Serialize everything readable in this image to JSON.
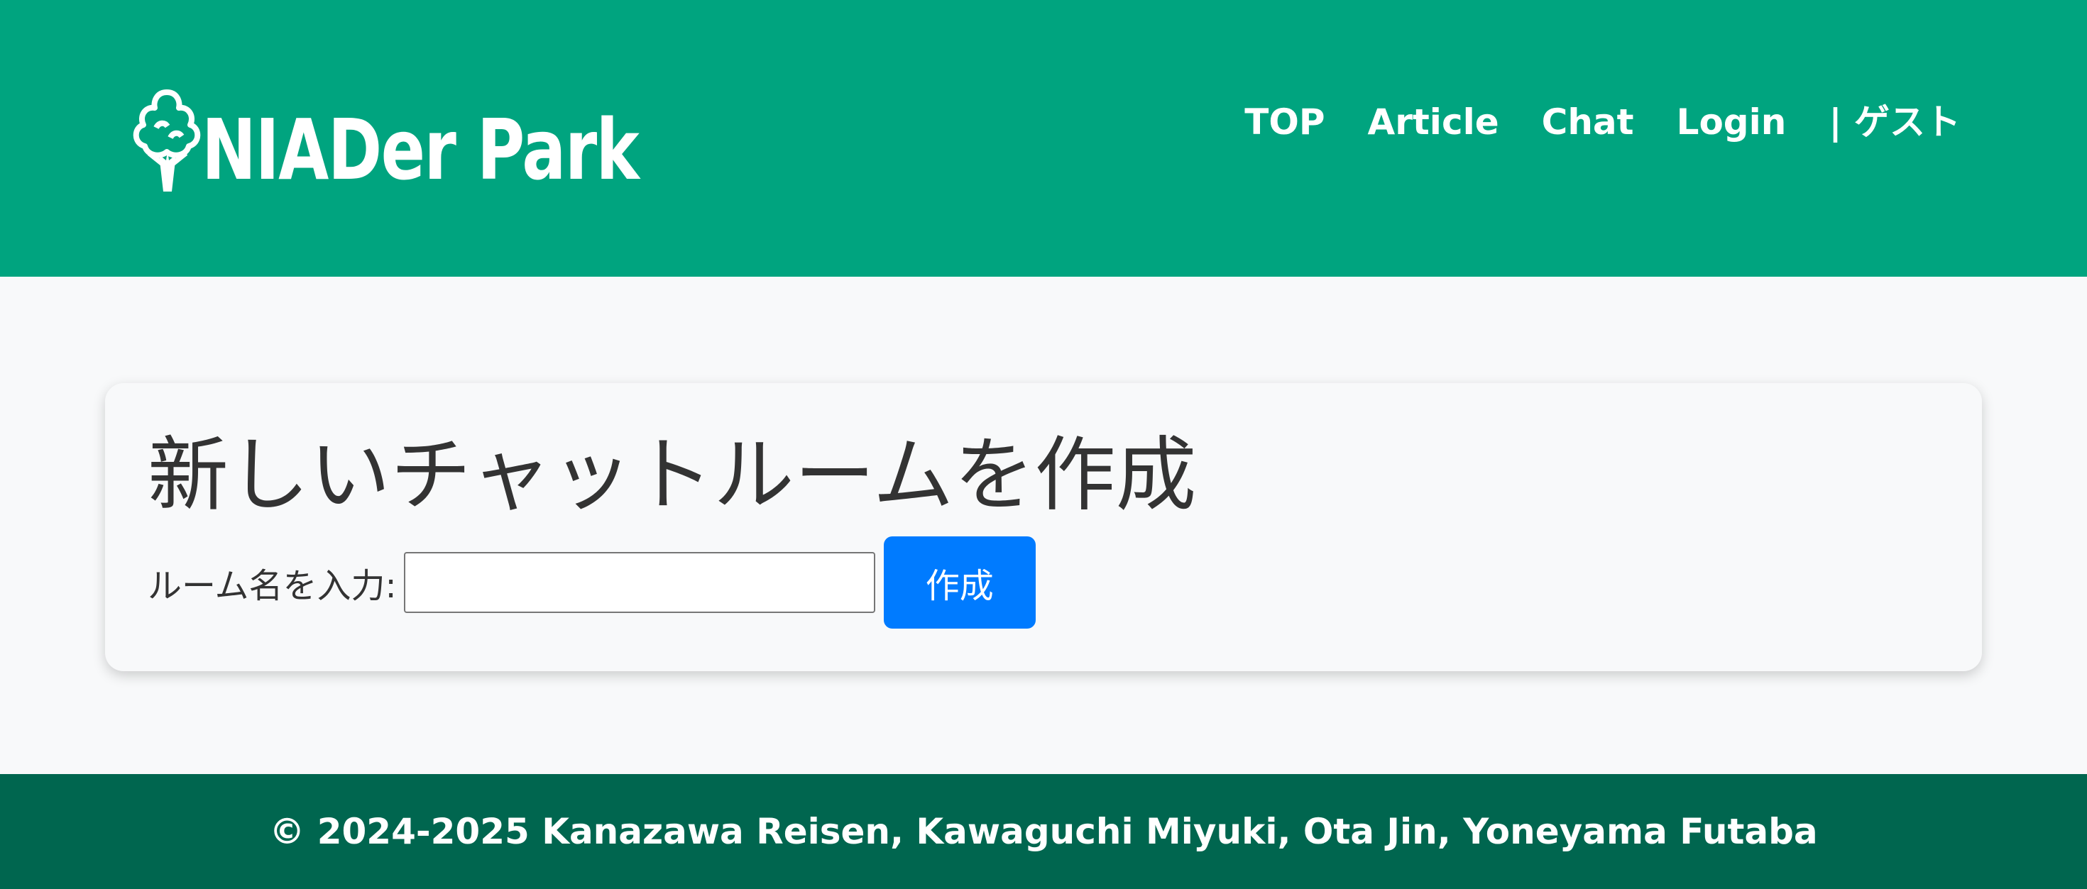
{
  "header": {
    "logo_text": "NIADer Park",
    "nav": {
      "top": "TOP",
      "article": "Article",
      "chat": "Chat",
      "login": "Login",
      "user": "| ゲスト"
    }
  },
  "main": {
    "title": "新しいチャットルームを作成",
    "room_label": "ルーム名を入力:",
    "room_input_value": "",
    "create_button": "作成"
  },
  "footer": {
    "copyright": "© 2024-2025 Kanazawa Reisen, Kawaguchi Miyuki, Ota Jin, Yoneyama Futaba"
  },
  "colors": {
    "header_bg": "#00a47f",
    "footer_bg": "#00664f",
    "page_bg": "#f8f9fa",
    "button_bg": "#007bff"
  },
  "icons": {
    "logo_mark": "tree-icon"
  }
}
